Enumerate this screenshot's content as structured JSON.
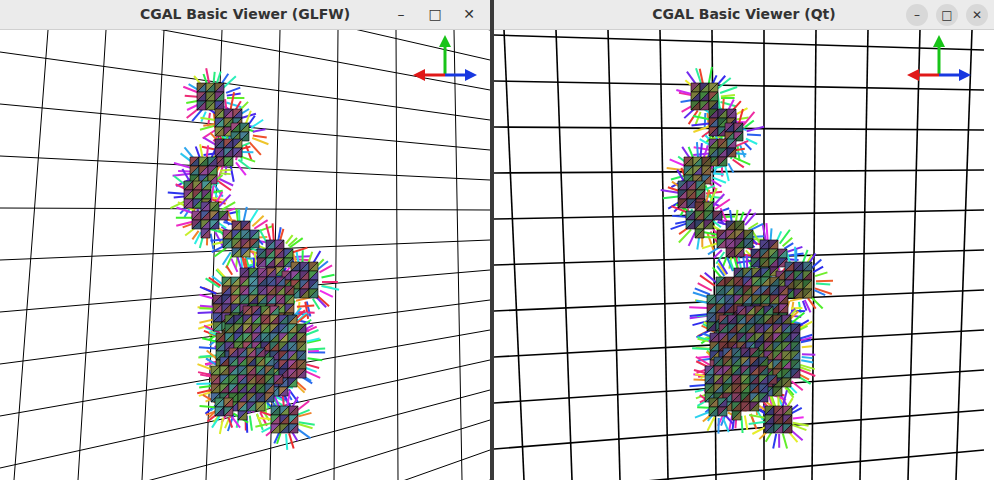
{
  "windows": [
    {
      "title": "CGAL Basic Viewer (GLFW)",
      "kind": "glfw",
      "controls": [
        "–",
        "□",
        "✕"
      ]
    },
    {
      "title": "CGAL Basic Viewer (Qt)",
      "kind": "qt",
      "controls": [
        "–",
        "□",
        "✕"
      ]
    }
  ]
}
